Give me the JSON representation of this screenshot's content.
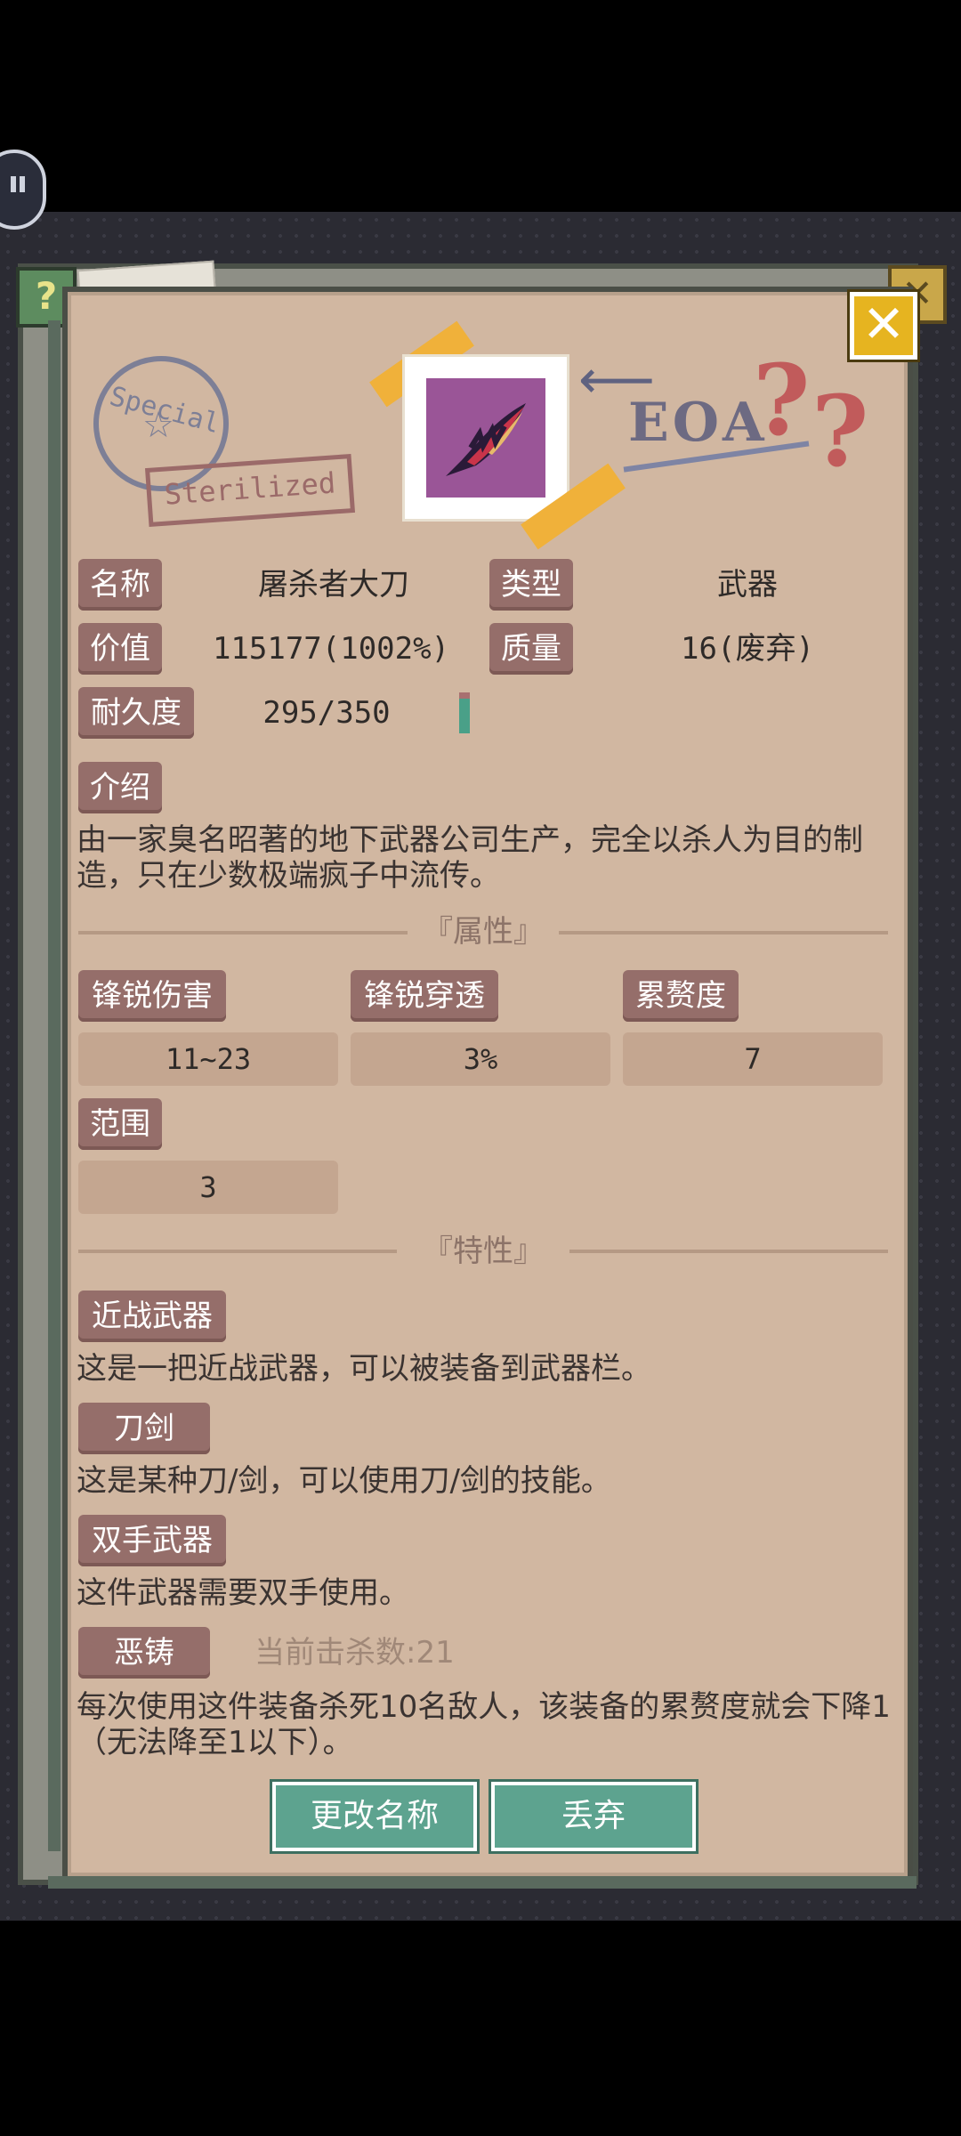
{
  "header": {
    "stamp_text": "Special",
    "sterilized_text": "Sterilized",
    "eoa_text": "EOA",
    "close_label": "✕"
  },
  "item": {
    "name_label": "名称",
    "name_value": "屠杀者大刀",
    "type_label": "类型",
    "type_value": "武器",
    "price_label": "价值",
    "price_value": "115177(1002%)",
    "quality_label": "质量",
    "quality_value": "16(废弃)",
    "durability_label": "耐久度",
    "durability_value": "295/350",
    "durability_fraction": 0.843
  },
  "intro": {
    "label": "介绍",
    "text": "由一家臭名昭著的地下武器公司生产，完全以杀人为目的制造，只在少数极端疯子中流传。"
  },
  "attributes": {
    "title": "『属性』",
    "items": [
      {
        "label": "锋锐伤害",
        "value": "11~23"
      },
      {
        "label": "锋锐穿透",
        "value": "3%"
      },
      {
        "label": "累赘度",
        "value": "7"
      },
      {
        "label": "范围",
        "value": "3"
      }
    ]
  },
  "traits": {
    "title": "『特性』",
    "items": [
      {
        "label": "近战武器",
        "text": "这是一把近战武器，可以被装备到武器栏。"
      },
      {
        "label": "刀剑",
        "text": "这是某种刀/剑，可以使用刀/剑的技能。"
      },
      {
        "label": "双手武器",
        "text": "这件武器需要双手使用。"
      },
      {
        "label": "恶铸",
        "extra": "当前击杀数:21",
        "text": "每次使用这件装备杀死10名敌人，该装备的累赘度就会下降1（无法降至1以下）。"
      }
    ]
  },
  "buttons": {
    "rename": "更改名称",
    "discard": "丢弃"
  },
  "colors": {
    "card_bg": "#d1b7a1",
    "tag_bg": "#956e6a",
    "button_bg": "#5da38f",
    "close_bg": "#e6b420",
    "item_bg": "#9a5597"
  }
}
